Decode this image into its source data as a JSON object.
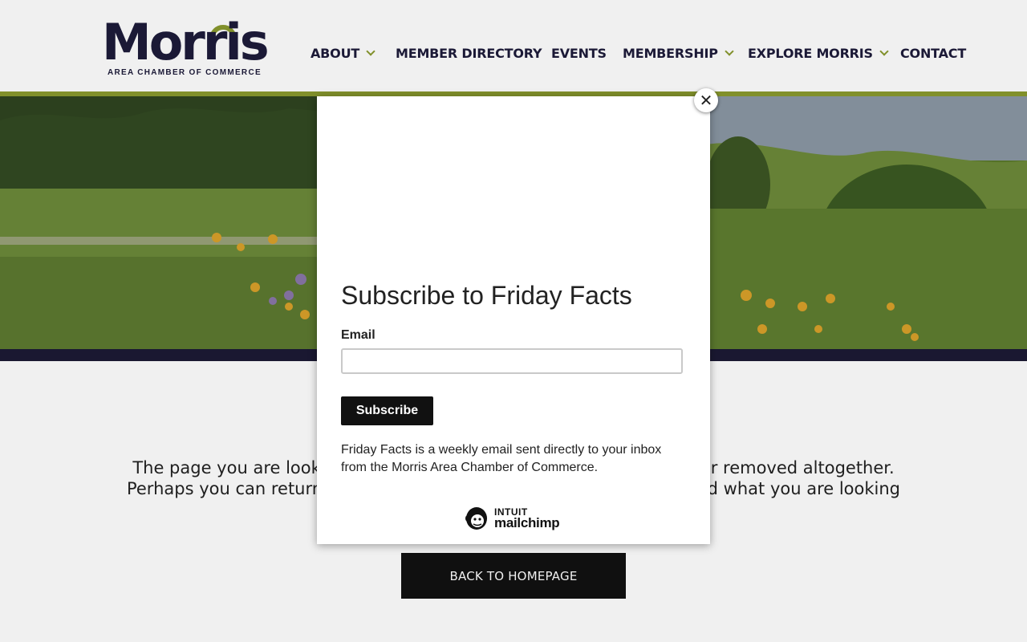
{
  "logo": {
    "wordmark": "Morris",
    "tagline": "AREA CHAMBER OF COMMERCE"
  },
  "nav": {
    "items": [
      {
        "label": "ABOUT",
        "has_dropdown": true
      },
      {
        "label": "MEMBER DIRECTORY",
        "has_dropdown": false
      },
      {
        "label": "EVENTS",
        "has_dropdown": false
      },
      {
        "label": "MEMBERSHIP",
        "has_dropdown": true
      },
      {
        "label": "EXPLORE MORRIS",
        "has_dropdown": true
      },
      {
        "label": "CONTACT",
        "has_dropdown": false
      }
    ]
  },
  "page": {
    "body_line1": "The page you are looki                                                                      or removed altogether.",
    "body_line2": "Perhaps you can return l                                                                  find what you are looking",
    "back_button": "BACK TO HOMEPAGE"
  },
  "modal": {
    "close_symbol": "✕",
    "title": "Subscribe to Friday Facts",
    "email_label": "Email",
    "email_value": "",
    "subscribe_label": "Subscribe",
    "description": "Friday Facts is a weekly email sent directly to your inbox from the Morris Area Chamber of Commerce.",
    "brand_intuit": "INTUIT",
    "brand_mailchimp": "mailchimp"
  },
  "colors": {
    "accent_green": "#8a9a2e",
    "navy": "#1c1a35",
    "button_black": "#111111"
  }
}
